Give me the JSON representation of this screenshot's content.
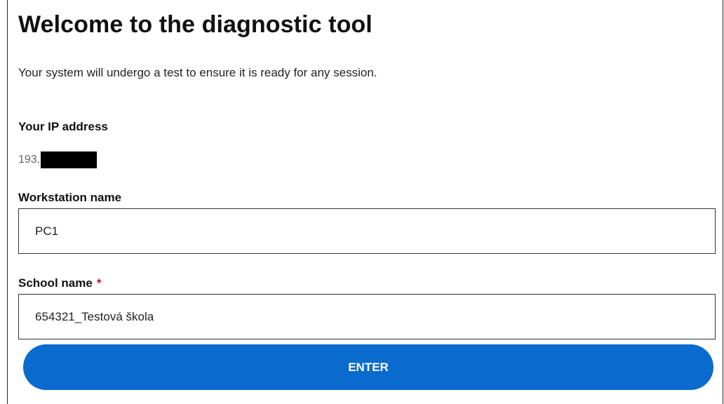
{
  "page": {
    "title": "Welcome to the diagnostic tool",
    "intro": "Your system will undergo a test to ensure it is ready for any session."
  },
  "ip": {
    "label": "Your IP address",
    "value_visible": "193."
  },
  "workstation": {
    "label": "Workstation name",
    "value": "PC1"
  },
  "school": {
    "label": "School name",
    "required_marker": "*",
    "value": "654321_Testová škola"
  },
  "actions": {
    "enter_label": "ENTER"
  },
  "colors": {
    "primary_button": "#0a6bce",
    "required_marker": "#c8102e",
    "field_border": "#333333"
  }
}
